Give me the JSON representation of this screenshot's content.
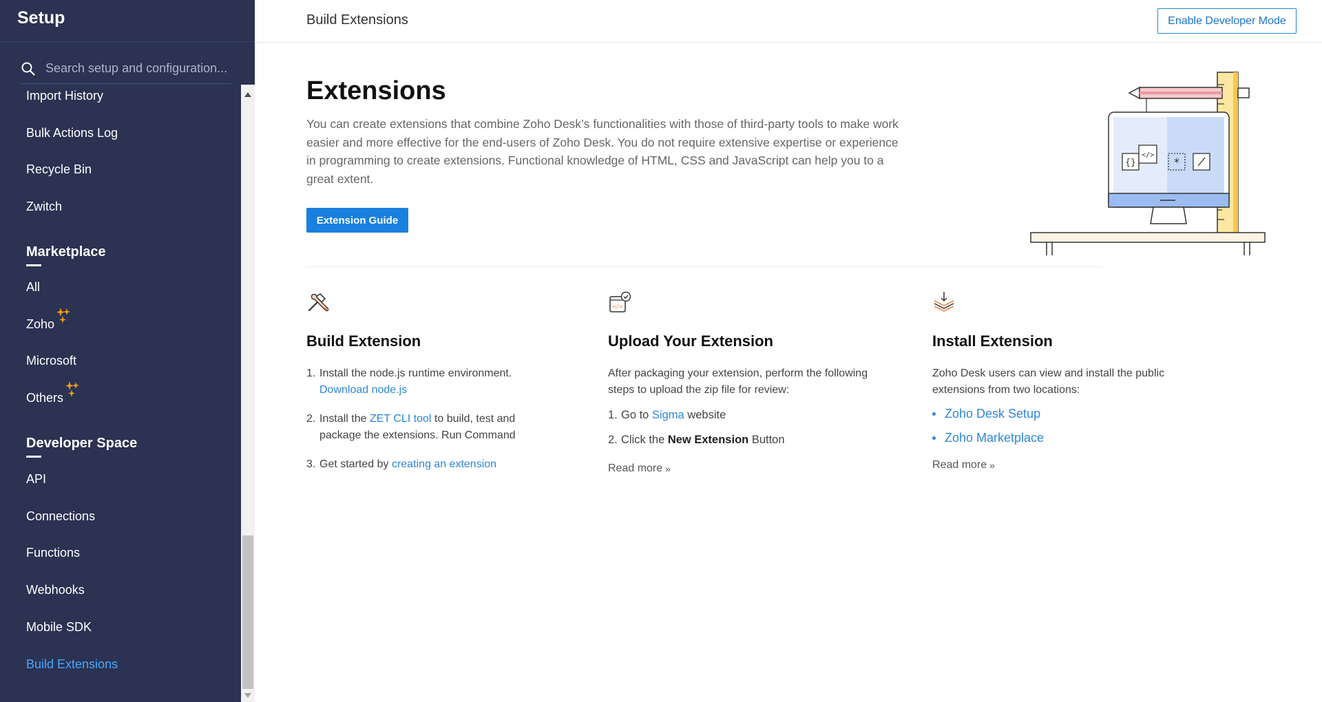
{
  "sidebar": {
    "title": "Setup",
    "search_placeholder": "Search setup and configuration...",
    "items_top": [
      {
        "label": "Import History"
      },
      {
        "label": "Bulk Actions Log"
      },
      {
        "label": "Recycle Bin"
      },
      {
        "label": "Zwitch"
      }
    ],
    "marketplace": {
      "heading": "Marketplace",
      "items": [
        {
          "label": "All"
        },
        {
          "label": "Zoho"
        },
        {
          "label": "Microsoft"
        },
        {
          "label": "Others"
        }
      ]
    },
    "developer_space": {
      "heading": "Developer Space",
      "items": [
        {
          "label": "API"
        },
        {
          "label": "Connections"
        },
        {
          "label": "Functions"
        },
        {
          "label": "Webhooks"
        },
        {
          "label": "Mobile SDK"
        },
        {
          "label": "Build Extensions"
        }
      ]
    },
    "active_color": "#46a7ff",
    "bg_color": "#2b3252"
  },
  "header": {
    "title": "Build Extensions",
    "dev_mode_button": "Enable Developer Mode"
  },
  "hero": {
    "title": "Extensions",
    "description": "You can create extensions that combine Zoho Desk’s functionalities with those of third-party tools to make work easier and more effective for the end-users of Zoho Desk. You do not require extensive expertise or experience in programming to create extensions. Functional knowledge of HTML, CSS and JavaScript can help you to a great extent.",
    "guide_button": "Extension Guide"
  },
  "build": {
    "icon": "hammer-wrench-icon",
    "title": "Build Extension",
    "step1_text": "Install the node.js runtime environment.",
    "step1_link": "Download node.js",
    "step2_pre": "Install the ",
    "step2_link": "ZET CLI tool",
    "step2_post": " to build, test and",
    "step2_line2": "package the extensions. Run Command",
    "step3_pre": "Get started by ",
    "step3_link": "creating an extension"
  },
  "upload": {
    "icon": "code-file-check-icon",
    "title": "Upload Your Extension",
    "intro_line1": "After packaging your extension, perform the following",
    "intro_line2": "steps to upload the zip file for review:",
    "step1_pre": "Go to ",
    "step1_link": "Sigma",
    "step1_post": " website",
    "step2_pre": "Click the ",
    "step2_bold": "New Extension",
    "step2_post": " Button",
    "read_more": "Read more"
  },
  "install": {
    "icon": "layers-download-icon",
    "title": "Install Extension",
    "intro_line1": "Zoho Desk users can view and install the public",
    "intro_line2": "extensions from two locations:",
    "bullets": [
      {
        "label": "Zoho Desk Setup"
      },
      {
        "label": "Zoho Marketplace"
      }
    ],
    "read_more": "Read more"
  },
  "colors": {
    "accent_blue": "#1a80e0",
    "link_blue": "#2f86d8",
    "sparkle_orange": "#f39c12"
  }
}
